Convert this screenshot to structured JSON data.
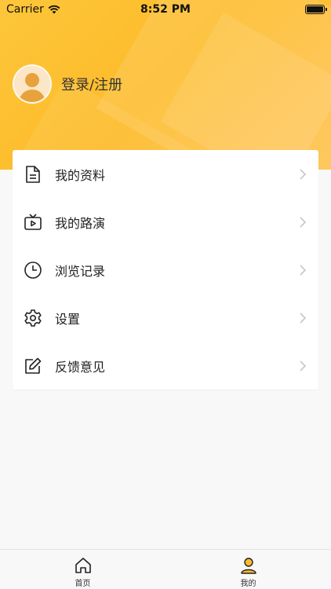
{
  "status_bar": {
    "carrier": "Carrier",
    "time": "8:52 PM",
    "battery_level": 1.0
  },
  "profile": {
    "login_label": "登录/注册"
  },
  "menu": {
    "items": [
      {
        "label": "我的资料",
        "icon": "document-icon"
      },
      {
        "label": "我的路演",
        "icon": "tv-play-icon"
      },
      {
        "label": "浏览记录",
        "icon": "clock-icon"
      },
      {
        "label": "设置",
        "icon": "gear-icon"
      },
      {
        "label": "反馈意见",
        "icon": "edit-icon"
      }
    ]
  },
  "tabbar": {
    "tabs": [
      {
        "label": "首页",
        "icon": "home-icon",
        "active": false
      },
      {
        "label": "我的",
        "icon": "user-icon",
        "active": true
      }
    ]
  },
  "colors": {
    "accent": "#fdbb2a",
    "background": "#f8f8f8",
    "card": "#ffffff"
  }
}
